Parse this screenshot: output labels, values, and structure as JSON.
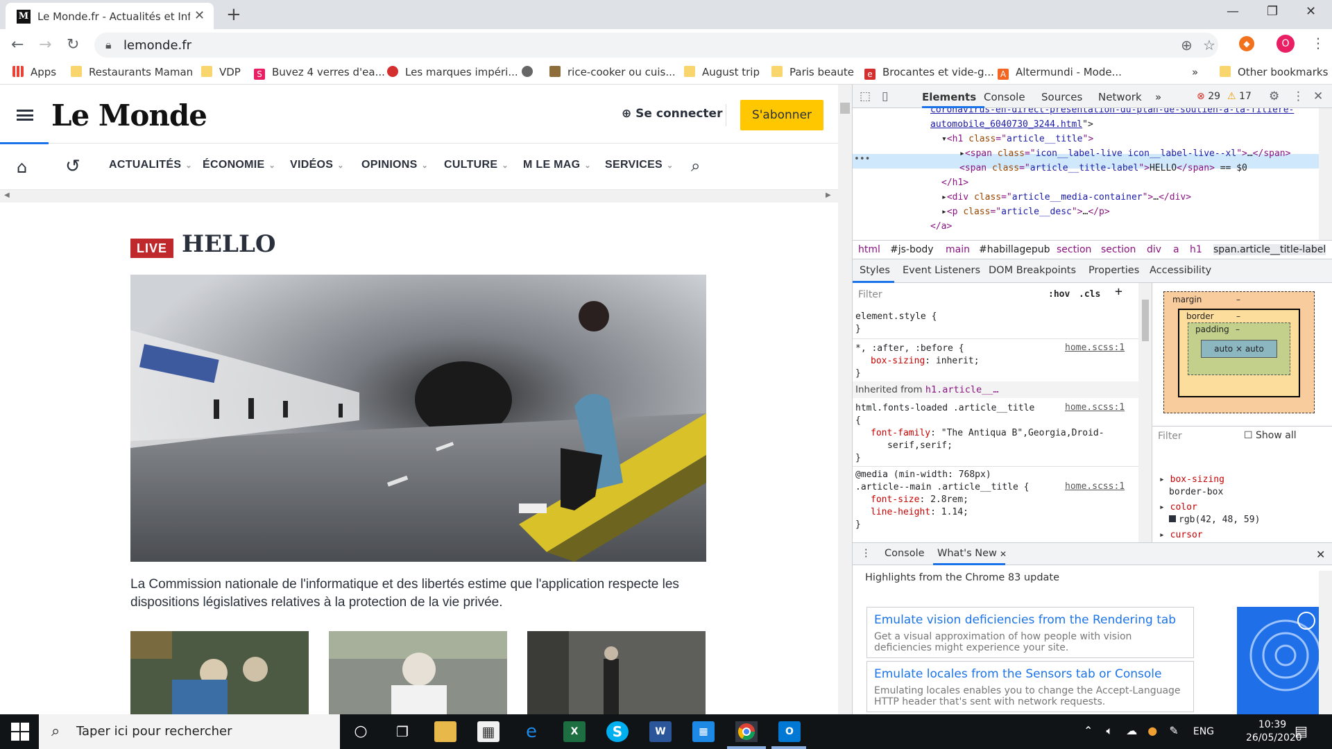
{
  "browser": {
    "tab_title": "Le Monde.fr - Actualités et Infos",
    "tab_favicon": "M",
    "url": "lemonde.fr",
    "profile_initial": "O",
    "bookmarks": [
      {
        "label": "Apps",
        "icon": "apps-grid-icon"
      },
      {
        "label": "Restaurants Maman",
        "icon": "folder-icon"
      },
      {
        "label": "VDP",
        "icon": "folder-icon"
      },
      {
        "label": "Buvez 4 verres d'ea...",
        "icon": "s-logo-icon"
      },
      {
        "label": "Les marques impéri...",
        "icon": "red-logo-icon"
      },
      {
        "label": "",
        "icon": "globe-icon"
      },
      {
        "label": "rice-cooker ou cuis...",
        "icon": "site-icon"
      },
      {
        "label": "August trip",
        "icon": "folder-icon"
      },
      {
        "label": "Paris beaute",
        "icon": "folder-icon"
      },
      {
        "label": "Brocantes et vide-g...",
        "icon": "e-logo-icon"
      },
      {
        "label": "Altermundi - Mode...",
        "icon": "a-logo-icon"
      },
      {
        "label": "Other bookmarks",
        "icon": "folder-icon"
      }
    ],
    "overflow": "»"
  },
  "site": {
    "logo": "Le Monde",
    "login": "Se connecter",
    "subscribe": "S'abonner",
    "nav": [
      "ACTUALITÉS",
      "ÉCONOMIE",
      "VIDÉOS",
      "OPINIONS",
      "CULTURE",
      "M LE MAG",
      "SERVICES"
    ],
    "live_badge": "LIVE",
    "headline": "HELLO",
    "description": "La Commission nationale de l'informatique et des libertés estime que l'application respecte les dispositions législatives relatives à la protection de la vie privée."
  },
  "devtools": {
    "tabs": [
      "Elements",
      "Console",
      "Sources",
      "Network"
    ],
    "more": "»",
    "errors": "29",
    "warnings": "17",
    "dom_lines": [
      {
        "indent": 0,
        "parts": [
          {
            "c": "lnk",
            "t": "coronavirus-en-direct-presentation-du-plan-de-soutien-a-la-filiere-"
          }
        ]
      },
      {
        "indent": 0,
        "parts": [
          {
            "c": "lnk",
            "t": "automobile_6040730_3244.html"
          },
          {
            "c": "txt",
            "t": "\">"
          }
        ]
      },
      {
        "indent": 1,
        "parts": [
          {
            "c": "txt",
            "t": "▾"
          },
          {
            "c": "tag",
            "t": "<h1 "
          },
          {
            "c": "attr",
            "t": "class"
          },
          {
            "c": "tag",
            "t": "=\""
          },
          {
            "c": "val",
            "t": "article__title"
          },
          {
            "c": "tag",
            "t": "\">"
          }
        ]
      },
      {
        "indent": 2,
        "parts": [
          {
            "c": "txt",
            "t": "▸"
          },
          {
            "c": "tag",
            "t": "<span "
          },
          {
            "c": "attr",
            "t": "class"
          },
          {
            "c": "tag",
            "t": "=\""
          },
          {
            "c": "val",
            "t": "icon__label-live icon__label-live--xl"
          },
          {
            "c": "tag",
            "t": "\">"
          },
          {
            "c": "txt",
            "t": "…"
          },
          {
            "c": "tag",
            "t": "</span>"
          }
        ]
      },
      {
        "indent": 2,
        "parts": [
          {
            "c": "tag",
            "t": "<span "
          },
          {
            "c": "attr",
            "t": "class"
          },
          {
            "c": "tag",
            "t": "=\""
          },
          {
            "c": "val",
            "t": "article__title-label"
          },
          {
            "c": "tag",
            "t": "\">"
          },
          {
            "c": "txt",
            "t": "HELLO"
          },
          {
            "c": "tag",
            "t": "</span>"
          },
          {
            "c": "txt",
            "t": " == $0"
          }
        ]
      },
      {
        "indent": 1,
        "parts": [
          {
            "c": "tag",
            "t": "</h1>"
          }
        ]
      },
      {
        "indent": 1,
        "parts": [
          {
            "c": "txt",
            "t": "▸"
          },
          {
            "c": "tag",
            "t": "<div "
          },
          {
            "c": "attr",
            "t": "class"
          },
          {
            "c": "tag",
            "t": "=\""
          },
          {
            "c": "val",
            "t": "article__media-container"
          },
          {
            "c": "tag",
            "t": "\">"
          },
          {
            "c": "txt",
            "t": "…"
          },
          {
            "c": "tag",
            "t": "</div>"
          }
        ]
      },
      {
        "indent": 1,
        "parts": [
          {
            "c": "txt",
            "t": "▸"
          },
          {
            "c": "tag",
            "t": "<p "
          },
          {
            "c": "attr",
            "t": "class"
          },
          {
            "c": "tag",
            "t": "=\""
          },
          {
            "c": "val",
            "t": "article__desc"
          },
          {
            "c": "tag",
            "t": "\">"
          },
          {
            "c": "txt",
            "t": "…"
          },
          {
            "c": "tag",
            "t": "</p>"
          }
        ]
      },
      {
        "indent": 0,
        "parts": [
          {
            "c": "tag",
            "t": "</a>"
          }
        ]
      }
    ],
    "breadcrumbs": [
      "html",
      "#js-body",
      "main",
      "#habillagepub",
      "section",
      "section",
      "div",
      "a",
      "h1",
      "span.article__title-label"
    ],
    "subtabs": [
      "Styles",
      "Event Listeners",
      "DOM Breakpoints",
      "Properties",
      "Accessibility"
    ],
    "filter_placeholder": "Filter",
    "hov": ":hov",
    "cls": ".cls",
    "element_style": "element.style {",
    "rule1_selector": "*, :after, :before {",
    "rule1_source": "home.scss:1",
    "rule1_prop": "box-sizing",
    "rule1_val": "inherit;",
    "inherited_label": "Inherited from",
    "inherited_from": "h1.article__…",
    "rule2_selector": "html.fonts-loaded .article__title",
    "rule2_source": "home.scss:1",
    "rule2_prop": "font-family",
    "rule2_val1": "\"The Antiqua B\",Georgia,Droid-",
    "rule2_val2": "serif,serif;",
    "rule3_media": "@media (min-width: 768px)",
    "rule3_selector": ".article--main .article__title {",
    "rule3_source": "home.scss:1",
    "rule3_prop1": "font-size",
    "rule3_val1": "2.8rem;",
    "rule3_prop2": "line-height",
    "rule3_val2": "1.14;",
    "box_margin": "margin",
    "box_border": "border",
    "box_padding": "padding",
    "box_content": "auto × auto",
    "box_dash": "–",
    "computed_filter": "Filter",
    "show_all": "Show all",
    "computed": [
      {
        "prop": "box-sizing",
        "val": "border-box"
      },
      {
        "prop": "color",
        "val": "rgb(42, 48, 59)"
      },
      {
        "prop": "cursor",
        "val": ""
      }
    ],
    "drawer_tabs": [
      "Console",
      "What's New"
    ],
    "highlights": "Highlights from the Chrome 83 update",
    "cards": [
      {
        "title": "Emulate vision deficiencies from the Rendering tab",
        "desc": "Get a visual approximation of how people with vision deficiencies might experience your site."
      },
      {
        "title": "Emulate locales from the Sensors tab or Console",
        "desc": "Emulating locales enables you to change the Accept-Language HTTP header that's sent with network requests."
      }
    ]
  },
  "taskbar": {
    "search_placeholder": "Taper ici pour rechercher",
    "lang": "ENG",
    "time": "10:39",
    "date": "26/05/2020",
    "apps": [
      "cortana-icon",
      "task-view-icon",
      "file-explorer-icon",
      "store-icon",
      "edge-icon",
      "excel-icon",
      "skype-icon",
      "word-icon",
      "calendar-icon",
      "chrome-icon",
      "outlook-icon"
    ]
  },
  "colors": {
    "subscribe": "#ffc700",
    "live": "#c0292c",
    "link_blue": "#1a73e8"
  }
}
